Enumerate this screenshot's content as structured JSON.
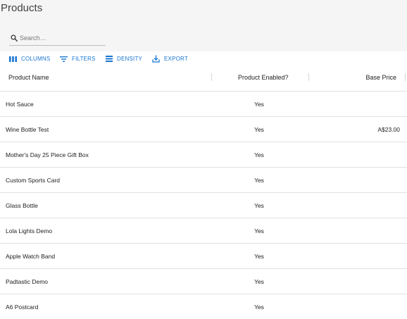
{
  "page": {
    "title": "Products"
  },
  "search": {
    "placeholder": "Search…",
    "value": ""
  },
  "toolbar": {
    "columns_label": "COLUMNS",
    "filters_label": "FILTERS",
    "density_label": "DENSITY",
    "export_label": "EXPORT",
    "accent_color": "#1976d2"
  },
  "grid": {
    "headers": {
      "name": "Product Name",
      "enabled": "Product Enabled?",
      "price": "Base Price"
    },
    "rows": [
      {
        "name": "Hot Sauce",
        "enabled": "Yes",
        "price": ""
      },
      {
        "name": "Wine Bottle Test",
        "enabled": "Yes",
        "price": "A$23.00"
      },
      {
        "name": "Mother's Day 25 Piece Gift Box",
        "enabled": "Yes",
        "price": ""
      },
      {
        "name": "Custom Sports Card",
        "enabled": "Yes",
        "price": ""
      },
      {
        "name": "Glass Bottle",
        "enabled": "Yes",
        "price": ""
      },
      {
        "name": "Lola Lights Demo",
        "enabled": "Yes",
        "price": ""
      },
      {
        "name": "Apple Watch Band",
        "enabled": "Yes",
        "price": ""
      },
      {
        "name": "Padtastic Demo",
        "enabled": "Yes",
        "price": ""
      },
      {
        "name": "A6 Postcard",
        "enabled": "Yes",
        "price": ""
      }
    ]
  },
  "icons": {
    "search": "search-icon",
    "columns": "columns-icon",
    "filters": "filter-list-icon",
    "density": "density-icon",
    "export": "export-icon"
  }
}
